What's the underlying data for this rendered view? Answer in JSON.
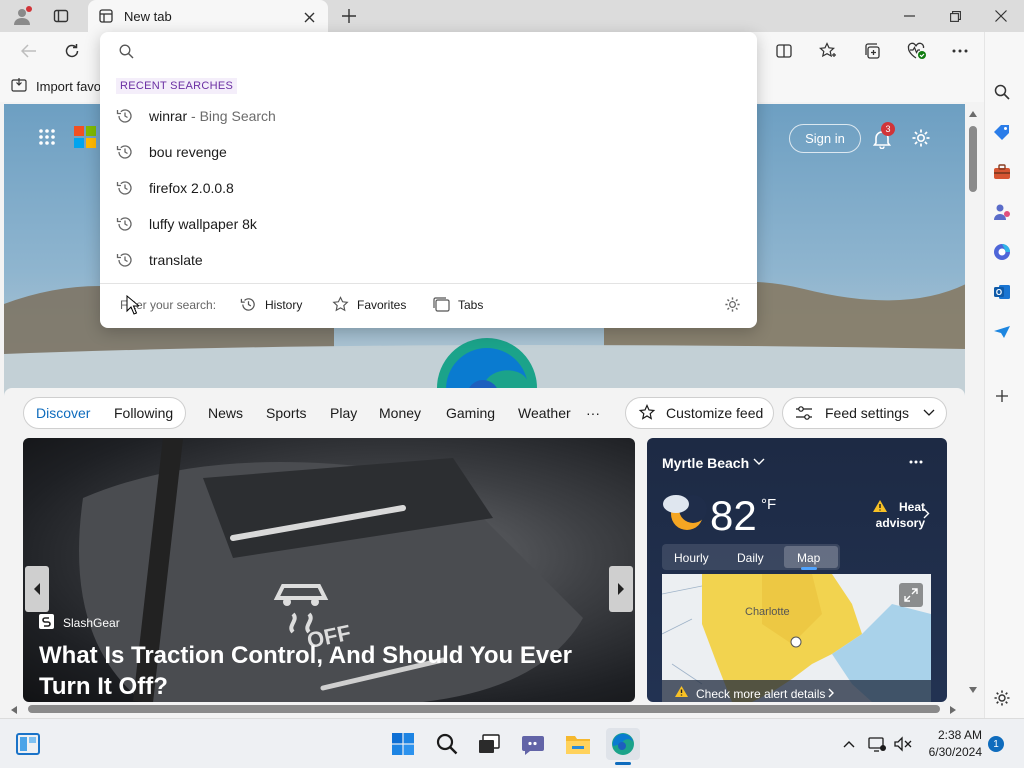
{
  "browser": {
    "tab_title": "New tab",
    "favorites_bar": {
      "import_label": "Import favo"
    }
  },
  "address_dropdown": {
    "section_header": "RECENT SEARCHES",
    "items": [
      {
        "text": "winrar",
        "suffix": " - Bing Search"
      },
      {
        "text": "bou revenge",
        "suffix": ""
      },
      {
        "text": "firefox 2.0.0.8",
        "suffix": ""
      },
      {
        "text": "luffy wallpaper 8k",
        "suffix": ""
      },
      {
        "text": "translate",
        "suffix": ""
      }
    ],
    "filter_label": "Filter your search:",
    "filters": [
      "History",
      "Favorites",
      "Tabs"
    ]
  },
  "ntp": {
    "sign_in": "Sign in",
    "notification_count": "3",
    "feed_nav": [
      "Discover",
      "Following",
      "News",
      "Sports",
      "Play",
      "Money",
      "Gaming",
      "Weather"
    ],
    "more": "···",
    "customize_feed": "Customize feed",
    "feed_settings": "Feed settings"
  },
  "hero_article": {
    "source": "SlashGear",
    "title": "What Is Traction Control, And Should You Ever Turn It Off?",
    "button_text": "OFF"
  },
  "weather": {
    "location": "Myrtle Beach",
    "temperature": "82",
    "unit": "°F",
    "alert": "Heat advisory",
    "tabs": [
      "Hourly",
      "Daily",
      "Map"
    ],
    "active_tab": "Map",
    "map_city": "Charlotte",
    "alert_link": "Check more alert details"
  },
  "taskbar": {
    "time": "2:38 AM",
    "date": "6/30/2024",
    "notification_badge": "1"
  },
  "colors": {
    "accent": "#0f6cbd",
    "dropdown_header": "#6b2fa3",
    "notification": "#d13438"
  }
}
